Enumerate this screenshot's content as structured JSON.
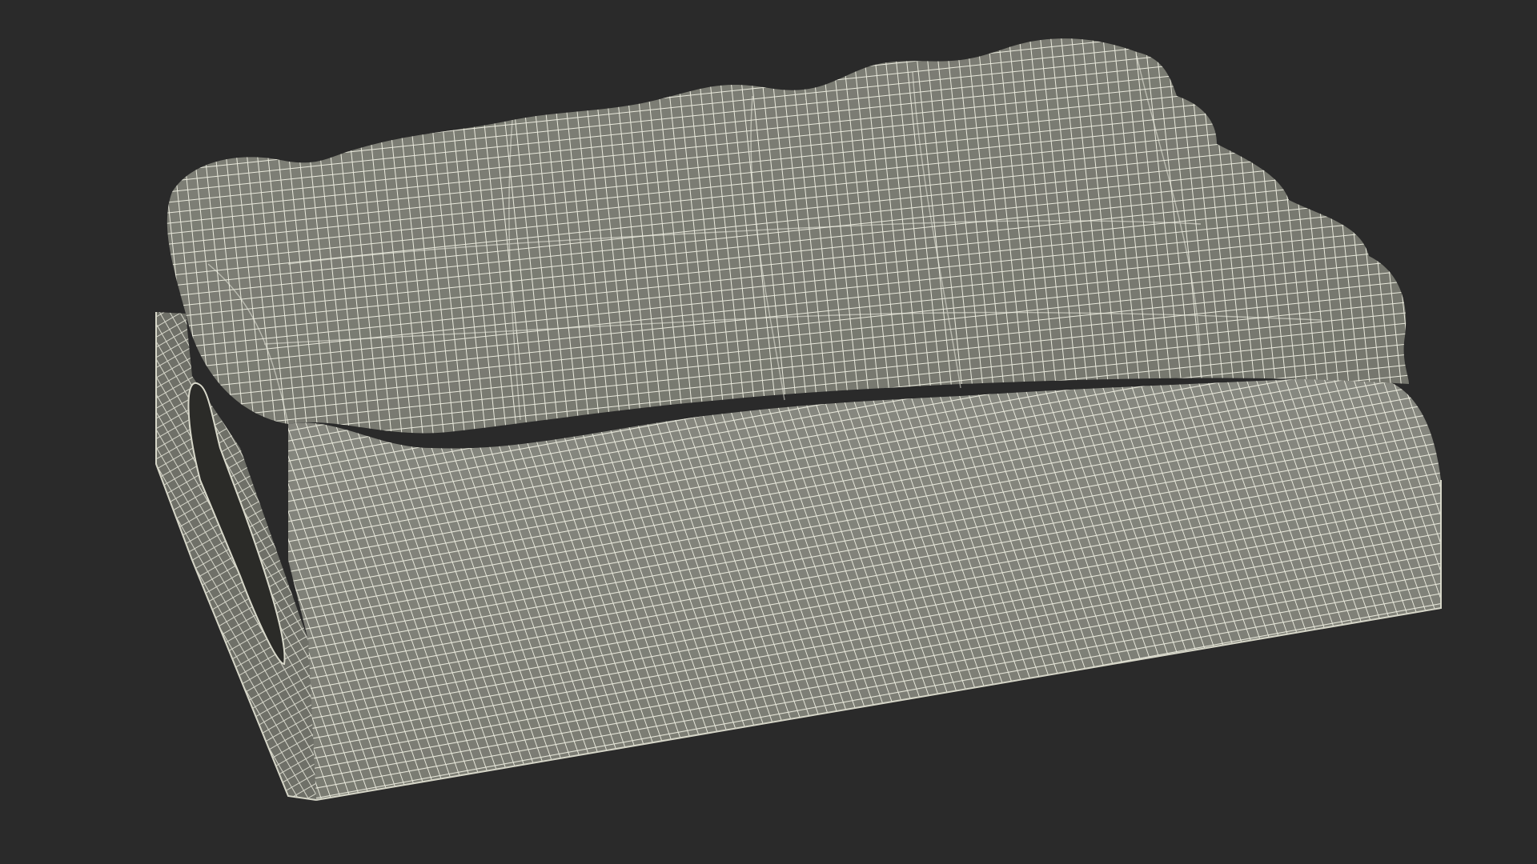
{
  "scene": {
    "subject": "wireframe-mesh",
    "colors": {
      "background": "#2a2a2a",
      "surface": "#7b7c72",
      "surface_dark": "#5f6058",
      "wire": "#e9e9dc",
      "handle_hole": "#2b2b28"
    }
  }
}
